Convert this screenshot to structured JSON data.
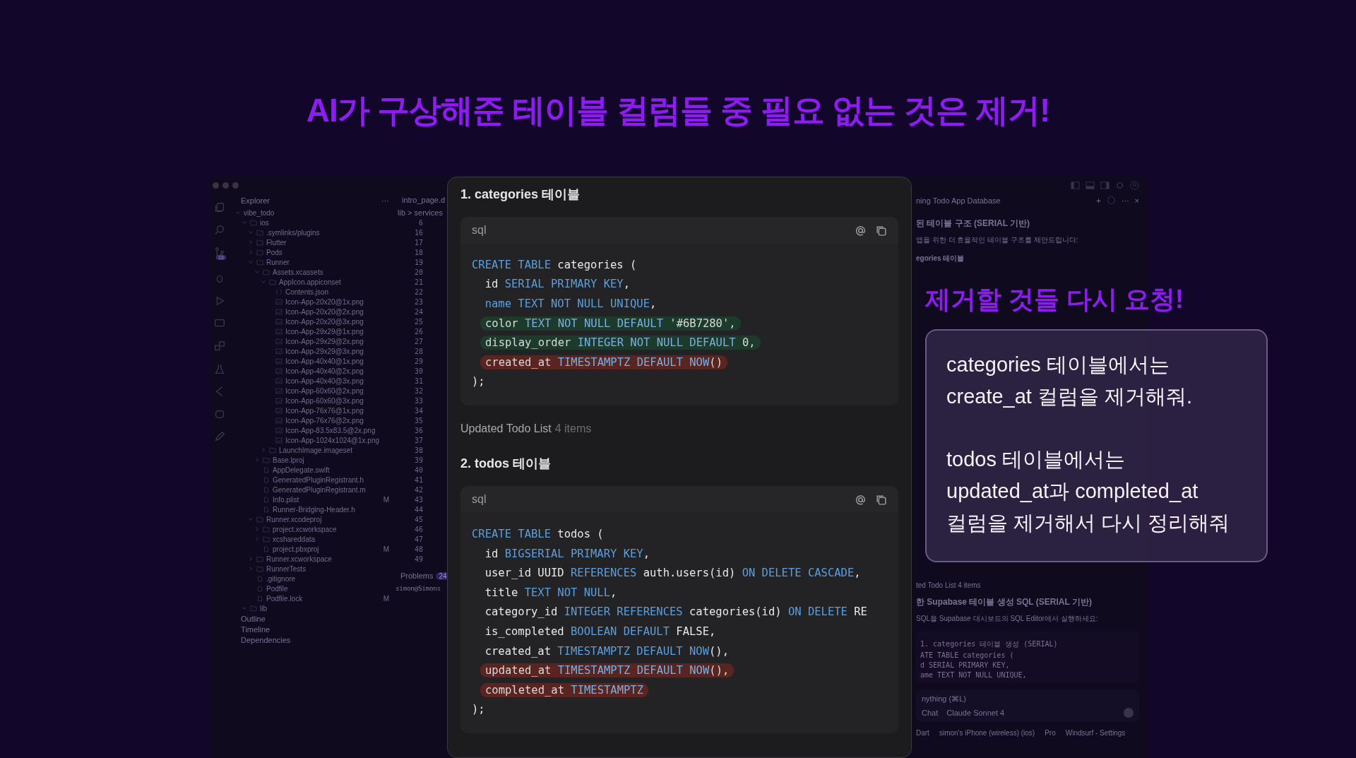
{
  "headline": "AI가 구상해준 테이블 컬럼들 중 필요 없는 것은 제거!",
  "editor": {
    "explorer": {
      "title": "Explorer",
      "menu": "···",
      "tree": [
        {
          "name": "vibe_todo",
          "kind": "root",
          "expanded": true,
          "children": [
            {
              "name": "ios",
              "kind": "folder",
              "expanded": true,
              "children": [
                {
                  "name": ".symlinks/plugins",
                  "kind": "folder",
                  "expanded": true
                },
                {
                  "name": "Flutter",
                  "kind": "folder",
                  "expanded": false
                },
                {
                  "name": "Pods",
                  "kind": "folder",
                  "expanded": false
                },
                {
                  "name": "Runner",
                  "kind": "folder",
                  "expanded": true,
                  "children": [
                    {
                      "name": "Assets.xcassets",
                      "kind": "folder",
                      "expanded": true,
                      "children": [
                        {
                          "name": "AppIcon.appiconset",
                          "kind": "folder",
                          "expanded": true,
                          "children": [
                            {
                              "name": "Contents.json",
                              "kind": "json"
                            },
                            {
                              "name": "Icon-App-20x20@1x.png",
                              "kind": "image"
                            },
                            {
                              "name": "Icon-App-20x20@2x.png",
                              "kind": "image"
                            },
                            {
                              "name": "Icon-App-20x20@3x.png",
                              "kind": "image"
                            },
                            {
                              "name": "Icon-App-29x29@1x.png",
                              "kind": "image"
                            },
                            {
                              "name": "Icon-App-29x29@2x.png",
                              "kind": "image"
                            },
                            {
                              "name": "Icon-App-29x29@3x.png",
                              "kind": "image"
                            },
                            {
                              "name": "Icon-App-40x40@1x.png",
                              "kind": "image"
                            },
                            {
                              "name": "Icon-App-40x40@2x.png",
                              "kind": "image"
                            },
                            {
                              "name": "Icon-App-40x40@3x.png",
                              "kind": "image"
                            },
                            {
                              "name": "Icon-App-60x60@2x.png",
                              "kind": "image"
                            },
                            {
                              "name": "Icon-App-60x60@3x.png",
                              "kind": "image"
                            },
                            {
                              "name": "Icon-App-76x76@1x.png",
                              "kind": "image"
                            },
                            {
                              "name": "Icon-App-76x76@2x.png",
                              "kind": "image"
                            },
                            {
                              "name": "Icon-App-83.5x83.5@2x.png",
                              "kind": "image"
                            },
                            {
                              "name": "Icon-App-1024x1024@1x.png",
                              "kind": "image"
                            }
                          ]
                        },
                        {
                          "name": "LaunchImage.imageset",
                          "kind": "folder",
                          "expanded": false
                        }
                      ]
                    },
                    {
                      "name": "Base.lproj",
                      "kind": "folder",
                      "expanded": false
                    },
                    {
                      "name": "AppDelegate.swift",
                      "kind": "file"
                    },
                    {
                      "name": "GeneratedPluginRegistrant.h",
                      "kind": "file"
                    },
                    {
                      "name": "GeneratedPluginRegistrant.m",
                      "kind": "file"
                    },
                    {
                      "name": "Info.plist",
                      "kind": "file",
                      "badge": "M"
                    },
                    {
                      "name": "Runner-Bridging-Header.h",
                      "kind": "file"
                    }
                  ]
                },
                {
                  "name": "Runner.xcodeproj",
                  "kind": "folder",
                  "expanded": true,
                  "children": [
                    {
                      "name": "project.xcworkspace",
                      "kind": "folder",
                      "expanded": false
                    },
                    {
                      "name": "xcshareddata",
                      "kind": "folder",
                      "expanded": false
                    },
                    {
                      "name": "project.pbxproj",
                      "kind": "file",
                      "badge": "M"
                    }
                  ]
                },
                {
                  "name": "Runner.xcworkspace",
                  "kind": "folder",
                  "expanded": false
                },
                {
                  "name": "RunnerTests",
                  "kind": "folder",
                  "expanded": false
                },
                {
                  "name": ".gitignore",
                  "kind": "file"
                },
                {
                  "name": "Podfile",
                  "kind": "file"
                },
                {
                  "name": "Podfile.lock",
                  "kind": "file",
                  "badge": "M"
                }
              ]
            },
            {
              "name": "lib",
              "kind": "folder",
              "expanded": true
            }
          ]
        }
      ],
      "sections": [
        "Outline",
        "Timeline",
        "Dependencies"
      ],
      "scm_badge": "18"
    },
    "code_strip": {
      "tab": "intro_page.d",
      "breadcrumb": "lib > services",
      "line_numbers": [
        "6",
        "16",
        "17",
        "18",
        "19",
        "20",
        "21",
        "22",
        "23",
        "24",
        "25",
        "26",
        "27",
        "28",
        "29",
        "30",
        "31",
        "32",
        "33",
        "34",
        "35",
        "36",
        "37",
        "38",
        "39",
        "40",
        "41",
        "42",
        "43",
        "44",
        "45",
        "46",
        "47",
        "48",
        "49"
      ],
      "problems": "Problems",
      "problems_count": "24",
      "terminal": "simon@Simons"
    },
    "chat": {
      "title": "ning Todo App Database",
      "heading": "된 테이블 구조 (SERIAL 기반)",
      "intro": "앱을 위한 더 효율적인 테이블 구조를 제안드립니다:",
      "subheading": "egories 테이블",
      "updated": "ted Todo List 4 items",
      "heading2": "한 Supabase 테이블 생성 SQL (SERIAL 기반)",
      "intro2": "SQL을 Supabase 대시보드의 SQL Editor에서 실행하세요:",
      "code": [
        "1. categories 테이블 생성 (SERIAL)",
        "ATE TABLE categories (",
        "d SERIAL PRIMARY KEY,",
        "ame TEXT NOT NULL UNIQUE,"
      ],
      "new_button": "+",
      "menu": "···",
      "close": "×",
      "input_placeholder": "nything (⌘L)",
      "mode": "Chat",
      "model": "Claude Sonnet 4",
      "status": [
        "Dart",
        "simon's iPhone (wireless) (ios)",
        "Pro",
        "Windsurf - Settings"
      ]
    }
  },
  "panel": {
    "sections": [
      {
        "title": "1. categories 테이블",
        "lang": "sql",
        "lines": [
          {
            "tokens": [
              {
                "t": "CREATE TABLE",
                "kind": "keyword"
              },
              {
                "t": " categories (",
                "kind": "plain"
              }
            ]
          },
          {
            "tokens": [
              {
                "t": "  id ",
                "kind": "plain"
              },
              {
                "t": "SERIAL PRIMARY KEY",
                "kind": "keyword"
              },
              {
                "t": ",",
                "kind": "plain"
              }
            ]
          },
          {
            "tokens": [
              {
                "t": "  name TEXT NOT NULL UNIQUE",
                "kind": "keyword"
              },
              {
                "t": ",",
                "kind": "plain"
              }
            ]
          },
          {
            "color": "#1d3b2d",
            "tokens": [
              {
                "t": "color ",
                "kind": "plain"
              },
              {
                "t": "TEXT NOT NULL DEFAULT",
                "kind": "keyword"
              },
              {
                "t": " '#6B7280',",
                "kind": "plain"
              }
            ]
          },
          {
            "color": "#1d3b2d",
            "tokens": [
              {
                "t": "display_order ",
                "kind": "plain"
              },
              {
                "t": "INTEGER NOT NULL DEFAULT",
                "kind": "keyword"
              },
              {
                "t": " 0,",
                "kind": "plain"
              }
            ]
          },
          {
            "color": "#5a2420",
            "tokens": [
              {
                "t": "created_at ",
                "kind": "plain"
              },
              {
                "t": "TIMESTAMPTZ DEFAULT NOW",
                "kind": "keyword"
              },
              {
                "t": "()",
                "kind": "plain"
              }
            ]
          },
          {
            "tokens": [
              {
                "t": ");",
                "kind": "plain"
              }
            ]
          }
        ]
      },
      {
        "note": "Updated Todo List",
        "note_count": "4 items"
      },
      {
        "title": "2. todos 테이블",
        "lang": "sql",
        "lines": [
          {
            "tokens": [
              {
                "t": "CREATE TABLE",
                "kind": "keyword"
              },
              {
                "t": " todos (",
                "kind": "plain"
              }
            ]
          },
          {
            "tokens": [
              {
                "t": "  id ",
                "kind": "plain"
              },
              {
                "t": "BIGSERIAL PRIMARY KEY",
                "kind": "keyword"
              },
              {
                "t": ",",
                "kind": "plain"
              }
            ]
          },
          {
            "tokens": [
              {
                "t": "  user_id UUID ",
                "kind": "plain"
              },
              {
                "t": "REFERENCES",
                "kind": "keyword"
              },
              {
                "t": " auth.users(id) ",
                "kind": "plain"
              },
              {
                "t": "ON DELETE CASCADE",
                "kind": "keyword"
              },
              {
                "t": ",",
                "kind": "plain"
              }
            ]
          },
          {
            "tokens": [
              {
                "t": "  title ",
                "kind": "plain"
              },
              {
                "t": "TEXT NOT NULL",
                "kind": "keyword"
              },
              {
                "t": ",",
                "kind": "plain"
              }
            ]
          },
          {
            "tokens": [
              {
                "t": "  category_id ",
                "kind": "plain"
              },
              {
                "t": "INTEGER REFERENCES",
                "kind": "keyword"
              },
              {
                "t": " categories(id) ",
                "kind": "plain"
              },
              {
                "t": "ON DELETE",
                "kind": "keyword"
              },
              {
                "t": " RE",
                "kind": "plain"
              }
            ]
          },
          {
            "tokens": [
              {
                "t": "  is_completed ",
                "kind": "plain"
              },
              {
                "t": "BOOLEAN DEFAULT",
                "kind": "keyword"
              },
              {
                "t": " FALSE,",
                "kind": "plain"
              }
            ]
          },
          {
            "tokens": [
              {
                "t": "  created_at ",
                "kind": "plain"
              },
              {
                "t": "TIMESTAMPTZ DEFAULT NOW",
                "kind": "keyword"
              },
              {
                "t": "(),",
                "kind": "plain"
              }
            ]
          },
          {
            "color": "#5a2420",
            "tokens": [
              {
                "t": "updated_at ",
                "kind": "plain"
              },
              {
                "t": "TIMESTAMPTZ DEFAULT NOW",
                "kind": "keyword"
              },
              {
                "t": "(),",
                "kind": "plain"
              }
            ]
          },
          {
            "color": "#5a2420",
            "tokens": [
              {
                "t": "completed_at ",
                "kind": "plain"
              },
              {
                "t": "TIMESTAMPTZ",
                "kind": "keyword"
              }
            ]
          },
          {
            "tokens": [
              {
                "t": ");",
                "kind": "plain"
              }
            ]
          }
        ]
      }
    ]
  },
  "callout": {
    "title": "제거할 것들 다시 요청!",
    "paragraphs": [
      [
        "categories 테이블에서는",
        "create_at 컬럼을 제거해줘."
      ],
      [
        "todos 테이블에서는",
        "updated_at과 completed_at",
        "컬럼을 제거해서 다시 정리해줘"
      ]
    ]
  }
}
